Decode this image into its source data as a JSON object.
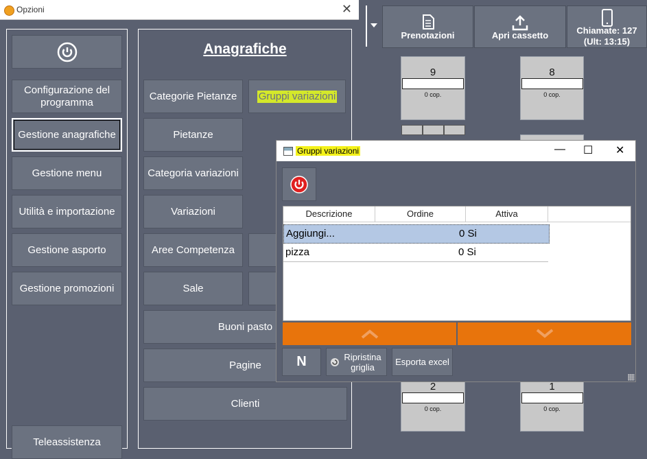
{
  "pos": {
    "menu_toggle_icon": "chevron-down-icon",
    "toolbar": [
      {
        "label": "Prenotazioni",
        "icon": "document-icon"
      },
      {
        "label": "Apri cassetto",
        "icon": "upload-icon"
      },
      {
        "label": "Chiamate: 127\n(Ult: 13:15)",
        "icon": "phone-icon"
      }
    ],
    "tables": [
      {
        "number": "9",
        "covers": "0 cop."
      },
      {
        "number": "8",
        "covers": "0 cop."
      },
      {
        "number": "2",
        "covers": "0 cop."
      },
      {
        "number": "1",
        "covers": "0 cop."
      }
    ]
  },
  "opzioni": {
    "title": "Opzioni",
    "close": "✕",
    "left_menu": [
      "Configurazione del programma",
      "Gestione anagrafiche",
      "Gestione menu",
      "Utilità e importazione",
      "Gestione asporto",
      "Gestione promozioni",
      "Teleassistenza"
    ],
    "selected_index": 1,
    "anagrafiche": {
      "title": "Anagrafiche",
      "buttons": [
        "Categorie Pietanze",
        "Gruppi variazioni",
        "Pietanze",
        "Categoria variazioni",
        "Variazioni",
        "Aree Competenza",
        "Sale",
        "Buoni pasto",
        "Pagine",
        "Clienti"
      ]
    }
  },
  "gruppi": {
    "title": "Gruppi variazioni",
    "minimize": "—",
    "maximize": "☐",
    "close": "✕",
    "columns": [
      "Descrizione",
      "Ordine",
      "Attiva"
    ],
    "rows": [
      {
        "descrizione": "Aggiungi...",
        "ordine": "0",
        "attiva": "Si"
      },
      {
        "descrizione": "pizza",
        "ordine": "0",
        "attiva": "Si"
      }
    ],
    "buttons": {
      "new": "N",
      "reset": "Ripristina griglia",
      "export": "Esporta excel"
    },
    "accent_color": "#e8740c"
  }
}
